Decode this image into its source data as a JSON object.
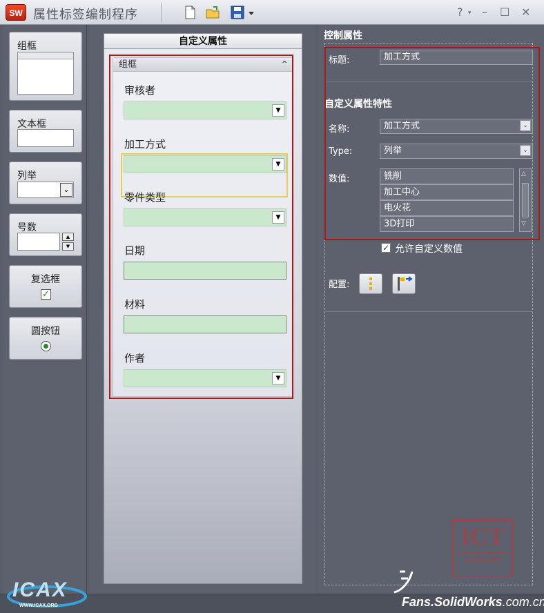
{
  "window": {
    "title": "属性标签编制程序",
    "logo_text": "SW",
    "help": "?",
    "minimize": "–",
    "maximize": "☐",
    "close": "✕"
  },
  "toolbox": {
    "group_box": "组框",
    "text_box": "文本框",
    "enum": "列举",
    "number": "号数",
    "checkbox": "复选框",
    "radio": "圆按钮"
  },
  "form": {
    "header": "自定义属性",
    "group_title": "组框",
    "fields": [
      {
        "label": "审核者",
        "type": "combo"
      },
      {
        "label": "加工方式",
        "type": "combo"
      },
      {
        "label": "零件类型",
        "type": "combo"
      },
      {
        "label": "日期",
        "type": "text"
      },
      {
        "label": "材料",
        "type": "text"
      },
      {
        "label": "作者",
        "type": "combo"
      }
    ]
  },
  "properties": {
    "control_header": "控制属性",
    "caption_label": "标题:",
    "caption_value": "加工方式",
    "custom_header": "自定义属性特性",
    "name_label": "名称:",
    "name_value": "加工方式",
    "type_label": "Type:",
    "type_value": "列举",
    "values_label": "数值:",
    "values": [
      "铣削",
      "加工中心",
      "电火花",
      "3D打印"
    ],
    "allow_custom": "允许自定义数值",
    "allow_custom_checked": true,
    "config_label": "配置:"
  },
  "watermarks": {
    "left_logo": "ICAX",
    "left_logo_sub": "WWW.ICAX.ORG",
    "ict_top": "ICT",
    "ict_bottom": "CAD/CAM",
    "fans_brand": "Fans.SolidWorks",
    "fans_domain": ".com.cn"
  },
  "colors": {
    "field_green": "#c9e8cc",
    "selection_yellow": "#e3cf58",
    "annotation_red": "#b01818",
    "panel_dark": "#5d616d"
  }
}
